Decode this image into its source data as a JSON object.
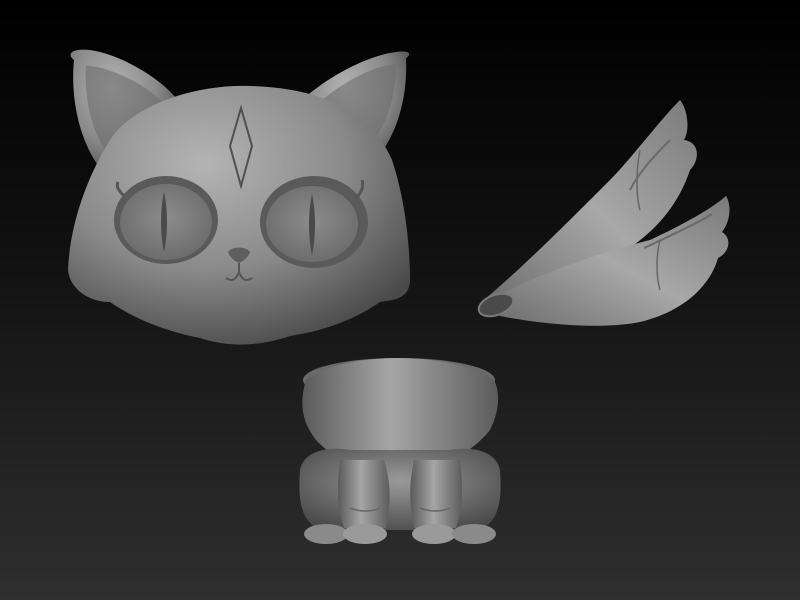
{
  "scene": {
    "background": {
      "top": "#000000",
      "bottom": "#303030"
    },
    "clay_color": "#8e8e8e",
    "parts": [
      {
        "name": "head",
        "icon": "cat-head-icon"
      },
      {
        "name": "tails",
        "icon": "tails-icon"
      },
      {
        "name": "body",
        "icon": "cat-body-icon"
      }
    ]
  }
}
